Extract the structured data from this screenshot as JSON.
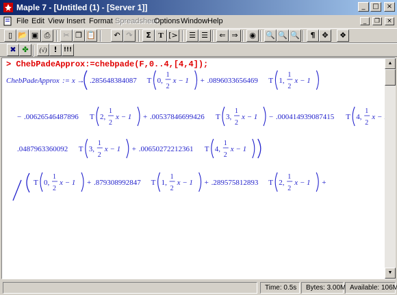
{
  "window": {
    "title": "Maple 7 - [Untitled (1) - [Server 1]]"
  },
  "menu": [
    "File",
    "Edit",
    "View",
    "Insert",
    "Format",
    "Spreadsheet",
    "Options",
    "Window",
    "Help"
  ],
  "menu_disabled": "Spreadsheet",
  "toolbar1": {
    "icons": [
      "new-icon",
      "open-icon",
      "save-icon",
      "print-icon",
      "cut-icon",
      "copy-icon",
      "paste-icon",
      "undo-icon",
      "redo-icon",
      "sigma-icon",
      "text-icon",
      "insert-prompt-icon",
      "indent-icon",
      "outdent-icon",
      "back-icon",
      "forward-icon",
      "stop-icon",
      "zoom-small-icon",
      "zoom-medium-icon",
      "zoom-large-icon",
      "pilcrow-icon",
      "expand-icon",
      "restart-icon"
    ]
  },
  "toolbar2": {
    "icons": [
      "stop-execution-icon",
      "maple-leaf-icon",
      "syntax-x-icon",
      "exclaim-icon",
      "triple-exclaim-icon"
    ],
    "labels": {
      "syntax": "(√)",
      "exec": "!",
      "exec_all": "!!!"
    }
  },
  "worksheet": {
    "prompt_symbol": ">",
    "input": "ChebPadeApprox:=chebpade(F,0..4,[4,4]);",
    "output": {
      "lhs": "ChebPadeApprox",
      "arrow": ":= x →",
      "numerator": [
        {
          "coef": ".285648384087",
          "deg": "0"
        },
        {
          "coef": ".0896033656469",
          "deg": "1"
        },
        {
          "coef": ".00626546487896",
          "deg": "2"
        },
        {
          "coef": ".00537846699426",
          "deg": "3"
        },
        {
          "coef": ".000414939087415",
          "deg": "4"
        }
      ],
      "denominator": [
        {
          "coef": "",
          "deg": "0"
        },
        {
          "coef": ".879308992847",
          "deg": "1"
        },
        {
          "coef": ".289575812893",
          "deg": "2"
        },
        {
          "coef": ".0487963360092",
          "deg": "3"
        },
        {
          "coef": ".00650272212361",
          "deg": "4"
        }
      ],
      "func": "T",
      "arg_frac_num": "1",
      "arg_frac_den": "2",
      "arg_rest": "x − 1"
    }
  },
  "status": {
    "time": "Time:  0.5s",
    "bytes": "Bytes: 3.00M",
    "available": "Available: 106M"
  },
  "colors": {
    "titlebar_start": "#0a246a",
    "titlebar_end": "#a6caf0",
    "input": "#e00000",
    "output": "#2222cc"
  }
}
